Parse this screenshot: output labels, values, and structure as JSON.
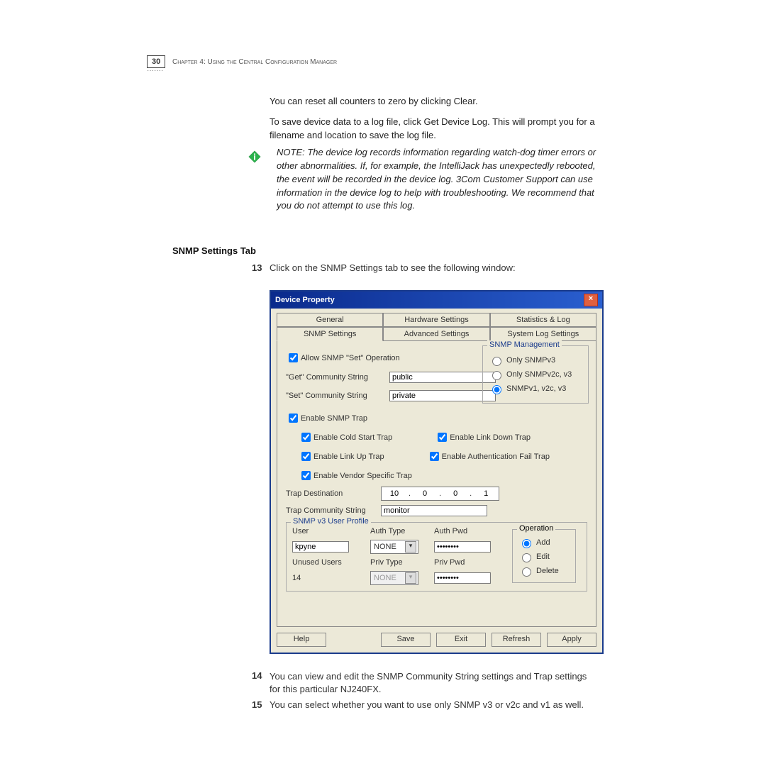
{
  "page_number": "30",
  "chapter_line": "Chapter 4: Using the Central Configuration Manager",
  "intro": {
    "p1": "You can reset all counters to zero by clicking Clear.",
    "p2": "To save device data to a log file, click Get Device Log. This will prompt you for a filename and location to save the log file."
  },
  "note": "NOTE: The device log records information regarding watch-dog timer errors or other abnormalities. If, for example, the IntelliJack has unexpectedly rebooted, the event will be recorded in the device log. 3Com Customer Support can use information in the device log to help with troubleshooting. We recommend that you do not attempt to use this log.",
  "section_heading": "SNMP Settings Tab",
  "steps": {
    "n13": "13",
    "t13": "Click on the SNMP Settings tab to see the following window:",
    "n14": "14",
    "t14": "You can view and edit the SNMP Community String settings and Trap settings for this particular NJ240FX.",
    "n15": "15",
    "t15": "You can select whether you want to use only SNMP v3 or v2c and v1 as well."
  },
  "dialog": {
    "title": "Device Property",
    "tabs": {
      "row1": [
        "General",
        "Hardware Settings",
        "Statistics & Log"
      ],
      "row2": [
        "SNMP Settings",
        "Advanced Settings",
        "System Log Settings"
      ]
    },
    "allow_set": "Allow SNMP \"Set\" Operation",
    "get_label": "\"Get\" Community String",
    "get_value": "public",
    "set_label": "\"Set\" Community String",
    "set_value": "private",
    "mgmt": {
      "legend": "SNMP Management",
      "r1": "Only SNMPv3",
      "r2": "Only SNMPv2c, v3",
      "r3": "SNMPv1, v2c, v3"
    },
    "trap": {
      "enable": "Enable SNMP Trap",
      "cold": "Enable Cold Start Trap",
      "linkdown": "Enable Link Down Trap",
      "linkup": "Enable Link Up Trap",
      "authfail": "Enable Authentication Fail Trap",
      "vendor": "Enable Vendor Specific Trap"
    },
    "trap_dest_label": "Trap Destination",
    "trap_dest": {
      "a": "10",
      "b": "0",
      "c": "0",
      "d": "1"
    },
    "trap_comm_label": "Trap Community String",
    "trap_comm_value": "monitor",
    "profile": {
      "legend": "SNMP v3 User Profile",
      "user_h": "User",
      "authtype_h": "Auth Type",
      "authpwd_h": "Auth Pwd",
      "user_val": "kpyne",
      "authtype_val": "NONE",
      "authpwd_val": "••••••••",
      "unused_h": "Unused Users",
      "privtype_h": "Priv Type",
      "privpwd_h": "Priv Pwd",
      "unused_val": "14",
      "privtype_val": "NONE",
      "privpwd_val": "••••••••",
      "op_legend": "Operation",
      "op_add": "Add",
      "op_edit": "Edit",
      "op_delete": "Delete"
    },
    "buttons": {
      "help": "Help",
      "save": "Save",
      "exit": "Exit",
      "refresh": "Refresh",
      "apply": "Apply"
    }
  }
}
